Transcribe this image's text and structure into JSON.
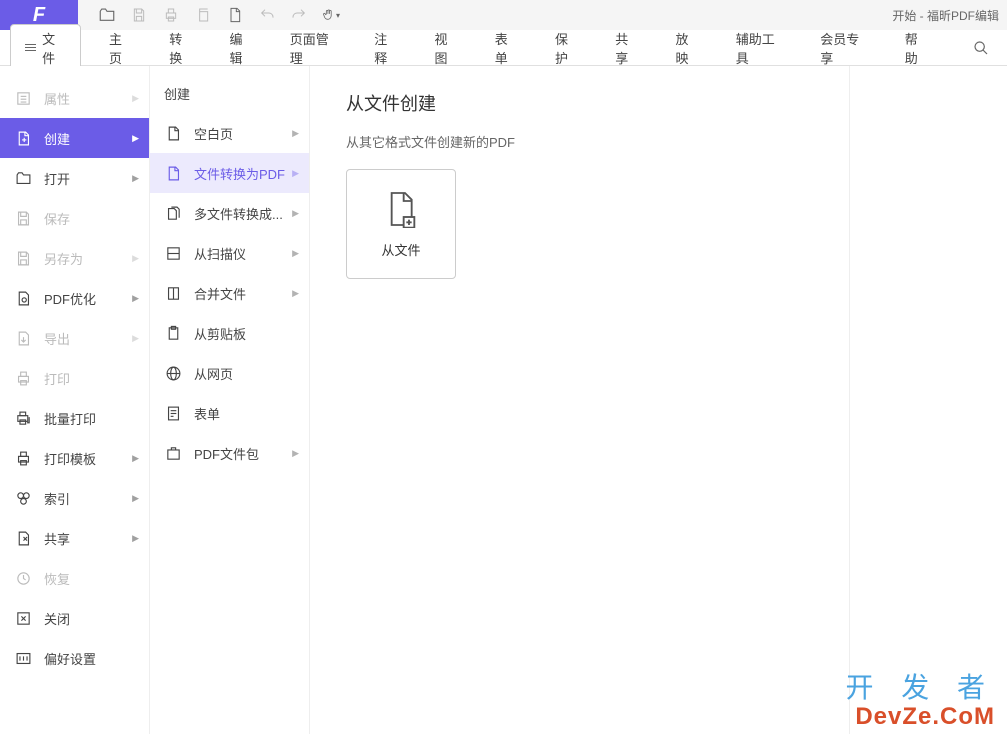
{
  "title": "开始 - 福昕PDF编辑",
  "file_button": "文件",
  "tabs": [
    "主页",
    "转换",
    "编辑",
    "页面管理",
    "注释",
    "视图",
    "表单",
    "保护",
    "共享",
    "放映",
    "辅助工具",
    "会员专享",
    "帮助"
  ],
  "col1": {
    "items": [
      {
        "label": "属性",
        "icon": "list",
        "disabled": true,
        "arrow": true
      },
      {
        "label": "创建",
        "icon": "new-doc",
        "active": true,
        "arrow": true
      },
      {
        "label": "打开",
        "icon": "open",
        "arrow": true
      },
      {
        "label": "保存",
        "icon": "save",
        "disabled": true
      },
      {
        "label": "另存为",
        "icon": "save-as",
        "disabled": true,
        "arrow": true
      },
      {
        "label": "PDF优化",
        "icon": "optimize",
        "arrow": true
      },
      {
        "label": "导出",
        "icon": "export",
        "disabled": true,
        "arrow": true
      },
      {
        "label": "打印",
        "icon": "print",
        "disabled": true
      },
      {
        "label": "批量打印",
        "icon": "batch-print"
      },
      {
        "label": "打印模板",
        "icon": "print-template",
        "arrow": true
      },
      {
        "label": "索引",
        "icon": "index",
        "arrow": true
      },
      {
        "label": "共享",
        "icon": "share",
        "arrow": true
      },
      {
        "label": "恢复",
        "icon": "restore",
        "disabled": true
      },
      {
        "label": "关闭",
        "icon": "close-doc"
      },
      {
        "label": "偏好设置",
        "icon": "prefs"
      }
    ]
  },
  "col2": {
    "header": "创建",
    "items": [
      {
        "label": "空白页",
        "icon": "blank",
        "arrow": true
      },
      {
        "label": "文件转换为PDF",
        "icon": "convert",
        "active": true,
        "arrow": true
      },
      {
        "label": "多文件转换成...",
        "icon": "multi",
        "arrow": true
      },
      {
        "label": "从扫描仪",
        "icon": "scanner",
        "arrow": true
      },
      {
        "label": "合并文件",
        "icon": "merge",
        "arrow": true
      },
      {
        "label": "从剪贴板",
        "icon": "clipboard"
      },
      {
        "label": "从网页",
        "icon": "web"
      },
      {
        "label": "表单",
        "icon": "form"
      },
      {
        "label": "PDF文件包",
        "icon": "portfolio",
        "arrow": true
      }
    ]
  },
  "col3": {
    "title": "从文件创建",
    "subtitle": "从其它格式文件创建新的PDF",
    "tile_label": "从文件"
  },
  "watermark": {
    "line1": "开 发 者",
    "line2": "DevZe.CoM"
  }
}
